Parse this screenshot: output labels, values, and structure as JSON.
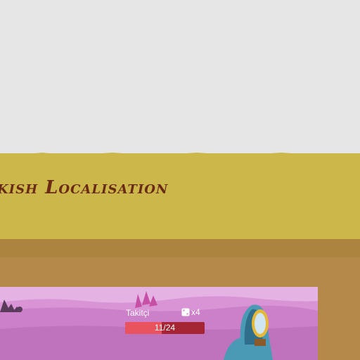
{
  "banner": {
    "title": "kish Localisation"
  },
  "game": {
    "character_name": "Takitçi",
    "dice_count": "x4",
    "hp_text": "11/24",
    "hp_fraction": 0.4583
  },
  "colors": {
    "background": "#e6e6e6",
    "banner": "#ccb84a",
    "title": "#6a2a14",
    "brown_panel": "#b5894a",
    "game_bg": "#d98ed6",
    "hp_bar": "#a52535",
    "hp_fill": "#e8535e"
  }
}
